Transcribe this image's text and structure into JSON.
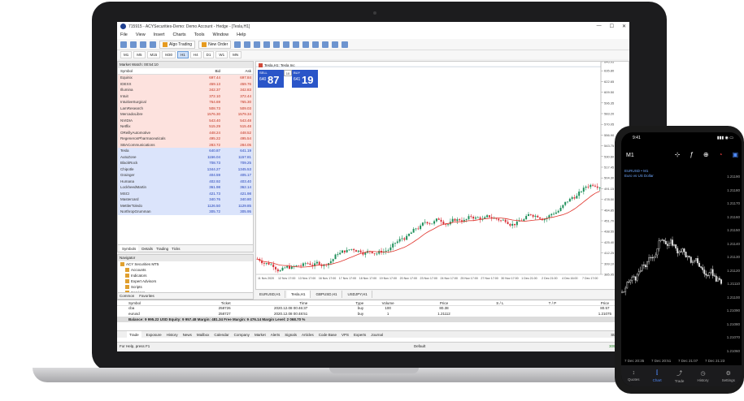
{
  "app": {
    "title": "715915 - ACYSecurities-Demo: Demo Account - Hedge - [Tesla,H1]",
    "window_controls": [
      "—",
      "☐",
      "✕"
    ]
  },
  "menu": [
    "File",
    "View",
    "Insert",
    "Charts",
    "Tools",
    "Window",
    "Help"
  ],
  "toolbar": {
    "algo_trading": "Algo Trading",
    "new_order": "New Order"
  },
  "timeframes": [
    "M1",
    "M5",
    "M15",
    "M30",
    "H1",
    "H4",
    "D1",
    "W1",
    "MN"
  ],
  "active_timeframe": "H1",
  "market_watch": {
    "title": "Market Watch: 00:54:10",
    "headers": {
      "symbol": "Symbol",
      "bid": "Bid",
      "ask": "Ask"
    },
    "rows": [
      {
        "symbol": "Equinix",
        "bid": "697.44",
        "ask": "697.84",
        "dir": "up"
      },
      {
        "symbol": "IDEXX",
        "bid": "459.13",
        "ask": "459.76",
        "dir": "up"
      },
      {
        "symbol": "Illumina",
        "bid": "342.37",
        "ask": "342.83",
        "dir": "up"
      },
      {
        "symbol": "Intuit",
        "bid": "372.10",
        "ask": "372.44",
        "dir": "up"
      },
      {
        "symbol": "IntuitiveSurgical",
        "bid": "764.69",
        "ask": "765.30",
        "dir": "up"
      },
      {
        "symbol": "LamResearch",
        "bid": "508.73",
        "ask": "509.03",
        "dir": "up"
      },
      {
        "symbol": "MercadoLibre",
        "bid": "1576.30",
        "ask": "1579.34",
        "dir": "up"
      },
      {
        "symbol": "NVIDIA",
        "bid": "543.40",
        "ask": "543.48",
        "dir": "up"
      },
      {
        "symbol": "Netflix",
        "bid": "515.29",
        "ask": "515.48",
        "dir": "up"
      },
      {
        "symbol": "OReillyAutomotive",
        "bid": "448.24",
        "ask": "448.52",
        "dir": "up"
      },
      {
        "symbol": "RegeneronPharmaceuticals",
        "bid": "495.22",
        "ask": "495.54",
        "dir": "up"
      },
      {
        "symbol": "SBACommunications",
        "bid": "283.72",
        "ask": "284.05",
        "dir": "up"
      },
      {
        "symbol": "Tesla",
        "bid": "640.87",
        "ask": "641.19",
        "dir": "dn"
      },
      {
        "symbol": "AutoZone",
        "bid": "1156.04",
        "ask": "1157.81",
        "dir": "dn"
      },
      {
        "symbol": "BlackRock",
        "bid": "708.73",
        "ask": "709.25",
        "dir": "dn"
      },
      {
        "symbol": "Chipotle",
        "bid": "1344.27",
        "ask": "1345.53",
        "dir": "dn"
      },
      {
        "symbol": "Grainger",
        "bid": "404.59",
        "ask": "405.17",
        "dir": "dn"
      },
      {
        "symbol": "Humana",
        "bid": "402.92",
        "ask": "403.40",
        "dir": "dn"
      },
      {
        "symbol": "LockheedMartin",
        "bid": "361.98",
        "ask": "362.14",
        "dir": "dn"
      },
      {
        "symbol": "MSCI",
        "bid": "421.73",
        "ask": "421.98",
        "dir": "dn"
      },
      {
        "symbol": "Mastercard",
        "bid": "340.76",
        "ask": "340.80",
        "dir": "dn"
      },
      {
        "symbol": "MettlerToledo",
        "bid": "1126.50",
        "ask": "1129.85",
        "dir": "dn"
      },
      {
        "symbol": "NorthropGrumman",
        "bid": "305.72",
        "ask": "305.95",
        "dir": "dn"
      }
    ],
    "tabs": [
      "Symbols",
      "Details",
      "Trading",
      "Ticks"
    ]
  },
  "navigator": {
    "title": "Navigator",
    "items": [
      "ACY Securities MT5",
      "Accounts",
      "Indicators",
      "Expert Advisors",
      "Scripts",
      "Services"
    ],
    "tabs": [
      "Common",
      "Favorites"
    ]
  },
  "chart": {
    "symbol_label": "Tesla,H1: Tesla Inc",
    "sell_label": "SELL",
    "buy_label": "BUY",
    "lot": "10",
    "sell_price_small": "640",
    "sell_price_big": "87",
    "buy_price_small": "641",
    "buy_price_big": "19",
    "price_axis": [
      "646.95",
      "635.80",
      "622.65",
      "609.50",
      "596.35",
      "583.20",
      "570.05",
      "556.90",
      "543.75",
      "530.60",
      "517.45",
      "504.30",
      "491.15",
      "478.00",
      "464.85",
      "451.70",
      "438.55",
      "425.40",
      "412.25",
      "399.10",
      "385.95"
    ],
    "time_axis": [
      "11 Nov 2020",
      "12 Nov 17:00",
      "13 Nov 17:00",
      "16 Nov 17:00",
      "17 Nov 17:00",
      "18 Nov 17:00",
      "19 Nov 17:00",
      "20 Nov 17:00",
      "23 Nov 17:00",
      "24 Nov 17:00",
      "25 Nov 17:00",
      "27 Nov 17:00",
      "30 Nov 17:00",
      "1 Dec 21:00",
      "2 Dec 21:00",
      "4 Dec 16:00",
      "7 Dec 17:00"
    ],
    "tabs": [
      "EURUSD,H1",
      "Tesla,H1",
      "GBPUSD,H1",
      "USDJPY,H1"
    ],
    "active_tab": "Tesla,H1",
    "colors": {
      "bull": "#1e8f5a",
      "bear": "#d8323a",
      "ma": "#e0342c",
      "bg": "#ffffff"
    }
  },
  "toolbox": {
    "headers": [
      "Symbol",
      "Ticket",
      "Time",
      "Type",
      "Volume",
      "Price",
      "S / L",
      "T / P",
      "Price"
    ],
    "rows": [
      [
        "cba",
        "258726",
        "2020.12.08 00:46:37",
        "buy",
        "100",
        "80.38",
        "",
        "",
        "80.57"
      ],
      [
        "eurusd",
        "258727",
        "2020.12.08 00:48:51",
        "buy",
        "1",
        "1.21112",
        "",
        "",
        "1.21075"
      ]
    ],
    "balance": "Balance: 9 995.22 USD  Equity: 9 957.48  Margin: 481.34  Free Margin: 9 476.14  Margin Level: 2 068.70 %",
    "tabs": [
      "Trade",
      "Exposure",
      "History",
      "News",
      "Mailbox",
      "Calendar",
      "Company",
      "Market",
      "Alerts",
      "Signals",
      "Articles",
      "Code Base",
      "VPS",
      "Experts",
      "Journal"
    ],
    "strategy": "Strategy"
  },
  "status": {
    "help": "For Help, press F1",
    "profile": "Default",
    "ping": "309.72 ms"
  },
  "phone": {
    "time": "9:41",
    "timeframe": "M1",
    "symbol": "EURUSD • M1",
    "symbol_desc": "Euro vs US Dollar",
    "price_axis": [
      "1.21190",
      "1.21180",
      "1.21170",
      "1.21160",
      "1.21150",
      "1.21140",
      "1.21130",
      "1.21120",
      "1.21110",
      "1.21100",
      "1.21090",
      "1.21080",
      "1.21070",
      "1.21060"
    ],
    "time_axis": [
      "7 Dec 20:35",
      "7 Dec 20:51",
      "7 Dec 21:07",
      "7 Dec 21:23"
    ],
    "nav": [
      {
        "label": "Quotes",
        "icon": "↕",
        "active": false
      },
      {
        "label": "Chart",
        "icon": "⫿",
        "active": true
      },
      {
        "label": "Trade",
        "icon": "⤴",
        "active": false
      },
      {
        "label": "History",
        "icon": "◷",
        "active": false
      },
      {
        "label": "Settings",
        "icon": "⚙",
        "active": false
      }
    ]
  }
}
